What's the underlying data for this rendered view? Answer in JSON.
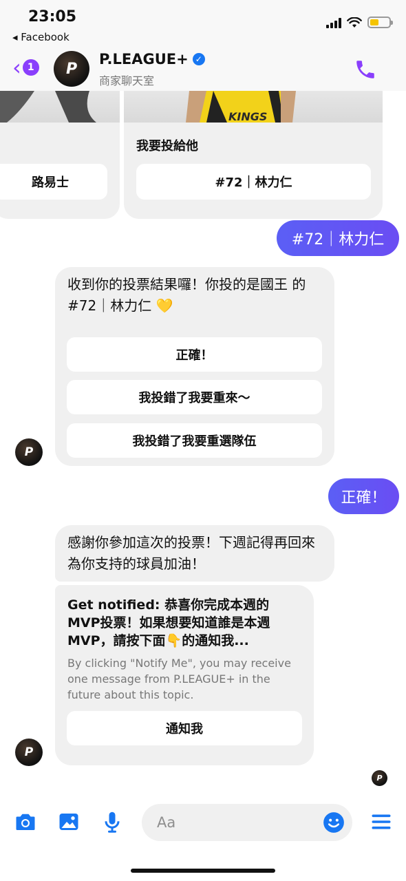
{
  "status_bar": {
    "time": "23:05",
    "back_app": "◂ Facebook"
  },
  "header": {
    "unread_count": "1",
    "avatar_text": "P",
    "name": "P.LEAGUE+",
    "verified_mark": "✓",
    "subtitle": "商家聊天室",
    "call_icon": "phone-icon"
  },
  "carousel": {
    "left_card": {
      "button": "路易士"
    },
    "right_card": {
      "image_text": "KINGS",
      "title": "我要投給他",
      "button": "#72｜林力仁"
    }
  },
  "messages": {
    "out1": "#72｜林力仁",
    "in1": {
      "text": "收到你的投票結果囉！你投的是國王 的 #72｜林力仁 💛",
      "buttons": [
        "正確！",
        "我投錯了我要重來～",
        "我投錯了我要重選隊伍"
      ]
    },
    "out2": "正確！",
    "in2": "感謝你參加這次的投票！下週記得再回來為你支持的球員加油！",
    "notify": {
      "title": "Get notified: 恭喜你完成本週的MVP投票！如果想要知道誰是本週MVP，請按下面👇的通知我...",
      "description": "By clicking \"Notify Me\", you may receive one message from P.LEAGUE+ in the future about this topic.",
      "button": "通知我"
    }
  },
  "composer": {
    "placeholder": "Aa"
  },
  "colors": {
    "accent": "#8a3ffc",
    "outgoing": "#6a55f7",
    "icon_blue": "#1877f2"
  }
}
